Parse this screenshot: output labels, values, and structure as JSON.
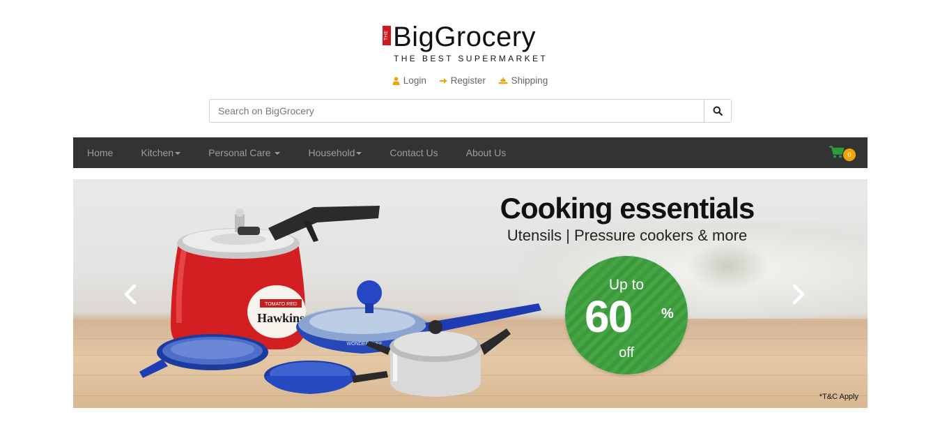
{
  "logo": {
    "tag": "THE",
    "name": "BigGrocery",
    "tagline": "THE BEST SUPERMARKET"
  },
  "top_links": [
    {
      "label": "Login",
      "icon": "user-icon"
    },
    {
      "label": "Register",
      "icon": "arrow-right-icon"
    },
    {
      "label": "Shipping",
      "icon": "shipping-icon"
    }
  ],
  "search": {
    "placeholder": "Search on BigGrocery",
    "value": "",
    "button_icon": "search-icon"
  },
  "nav": {
    "items": [
      {
        "label": "Home",
        "dropdown": false
      },
      {
        "label": "Kitchen",
        "dropdown": true
      },
      {
        "label": "Personal Care ",
        "dropdown": true
      },
      {
        "label": "Household",
        "dropdown": true
      },
      {
        "label": "Contact Us",
        "dropdown": false
      },
      {
        "label": "About Us",
        "dropdown": false
      }
    ],
    "cart_count": "0",
    "cart_icon": "shopping-cart-icon"
  },
  "banner": {
    "title": "Cooking essentials",
    "subtitle": "Utensils | Pressure cookers & more",
    "discount_prefix": "Up to",
    "discount_value": "60",
    "discount_unit": "%",
    "discount_suffix": "off",
    "terms": "*T&C Apply",
    "cooker_brand": "Hawkins",
    "cooker_label": "TOMATO RED",
    "pan_brand": "WONDERCHEF",
    "prev_icon": "chevron-left-icon",
    "next_icon": "chevron-right-icon"
  },
  "colors": {
    "nav_bg": "#333333",
    "nav_text": "#9d9d9d",
    "accent_orange": "#f0a30a",
    "cart_green": "#2e9a3a",
    "logo_red": "#d0171d",
    "discount_green": "#3d9a3c"
  }
}
